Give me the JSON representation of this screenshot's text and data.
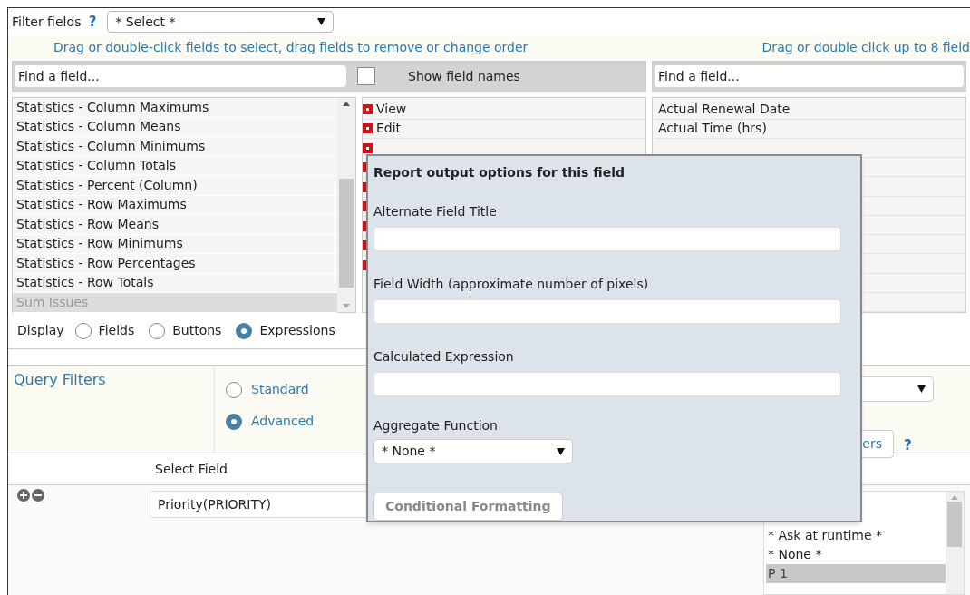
{
  "filter_fields": {
    "label": "Filter fields",
    "help": "?",
    "select": "* Select *"
  },
  "instructions": {
    "left": "Drag or double-click fields to select, drag fields to remove or change order",
    "right": "Drag or double click up to 8 field"
  },
  "available_panel": {
    "search_placeholder": "Find a field...",
    "show_field_names": {
      "label": "Show field names",
      "checked": false
    },
    "items": [
      {
        "label": "Statistics - Column Maximums",
        "disabled": false
      },
      {
        "label": "Statistics - Column Means",
        "disabled": false
      },
      {
        "label": "Statistics - Column Minimums",
        "disabled": false
      },
      {
        "label": "Statistics - Column Totals",
        "disabled": false
      },
      {
        "label": "Statistics - Percent (Column)",
        "disabled": false
      },
      {
        "label": "Statistics - Row Maximums",
        "disabled": false
      },
      {
        "label": "Statistics - Row Means",
        "disabled": false
      },
      {
        "label": "Statistics - Row Minimums",
        "disabled": false
      },
      {
        "label": "Statistics - Row Percentages",
        "disabled": false
      },
      {
        "label": "Statistics - Row Totals",
        "disabled": false
      },
      {
        "label": "Sum Issues",
        "disabled": true
      }
    ],
    "display": {
      "label": "Display",
      "options": [
        {
          "label": "Fields",
          "selected": false
        },
        {
          "label": "Buttons",
          "selected": false
        },
        {
          "label": "Expressions",
          "selected": true
        }
      ]
    }
  },
  "selected_fields": {
    "items": [
      {
        "label": "View"
      },
      {
        "label": "Edit"
      }
    ]
  },
  "sort_panel": {
    "search_placeholder": "Find a field...",
    "items": [
      {
        "label": "Actual Renewal Date"
      },
      {
        "label": "Actual Time (hrs)"
      }
    ]
  },
  "query_filters": {
    "title": "Query Filters",
    "modes": [
      {
        "label": "Standard",
        "selected": false
      },
      {
        "label": "Advanced",
        "selected": true
      }
    ],
    "button": "ers",
    "help": "?"
  },
  "filter_table": {
    "column": "Select Field",
    "field_value": "Priority(PRIORITY)",
    "values": [
      {
        "label": "* Ask at runtime *",
        "selected": false
      },
      {
        "label": "* None *",
        "selected": false
      },
      {
        "label": "P 1",
        "selected": true
      }
    ]
  },
  "popup": {
    "title": "Report output options for this field",
    "fields": [
      {
        "label": "Alternate Field Title"
      },
      {
        "label": "Field Width (approximate number of pixels)"
      },
      {
        "label": "Calculated Expression"
      }
    ],
    "aggregate": {
      "label": "Aggregate Function",
      "value": "* None *"
    },
    "button": "Conditional Formatting"
  }
}
